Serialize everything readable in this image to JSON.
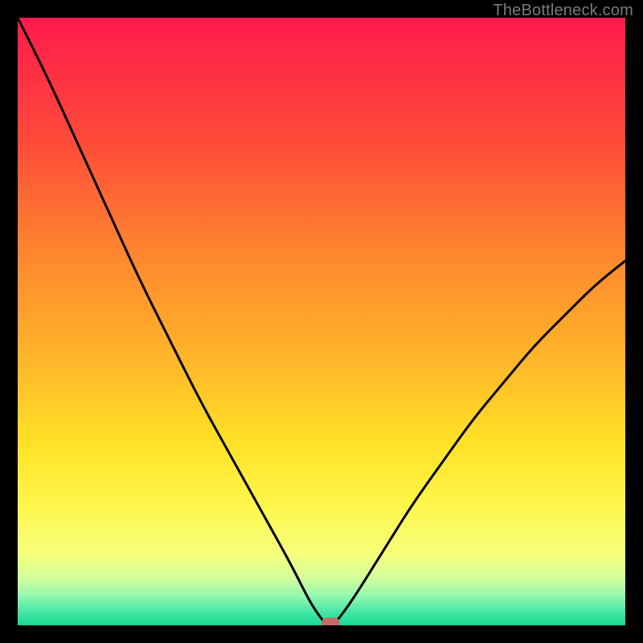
{
  "attribution": "TheBottleneck.com",
  "chart_data": {
    "type": "line",
    "title": "",
    "xlabel": "",
    "ylabel": "",
    "xlim": [
      0,
      100
    ],
    "ylim": [
      0,
      100
    ],
    "grid": false,
    "series": [
      {
        "name": "bottleneck-curve",
        "x": [
          0,
          5,
          10,
          15,
          20,
          25,
          30,
          35,
          40,
          45,
          48,
          50,
          51,
          52,
          55,
          60,
          65,
          70,
          75,
          80,
          85,
          90,
          95,
          100
        ],
        "values": [
          100,
          90,
          79,
          68,
          57,
          47,
          37,
          28,
          19,
          10,
          4,
          1,
          0,
          0,
          4,
          12,
          20,
          27,
          34,
          40,
          46,
          51,
          56,
          60
        ]
      }
    ],
    "marker": {
      "name": "optimal-point",
      "x": 51.5,
      "y": 0,
      "color": "#c96a63"
    },
    "background_gradient_stops": [
      {
        "offset": 0.0,
        "color": "#ff1a4d"
      },
      {
        "offset": 0.2,
        "color": "#ff4a3a"
      },
      {
        "offset": 0.4,
        "color": "#ff8a2e"
      },
      {
        "offset": 0.55,
        "color": "#ffb22a"
      },
      {
        "offset": 0.7,
        "color": "#ffe126"
      },
      {
        "offset": 0.8,
        "color": "#fff64a"
      },
      {
        "offset": 0.88,
        "color": "#f6ff7a"
      },
      {
        "offset": 0.92,
        "color": "#d6ff9a"
      },
      {
        "offset": 0.95,
        "color": "#98f8b0"
      },
      {
        "offset": 0.975,
        "color": "#4de9a6"
      },
      {
        "offset": 1.0,
        "color": "#17d894"
      }
    ]
  }
}
